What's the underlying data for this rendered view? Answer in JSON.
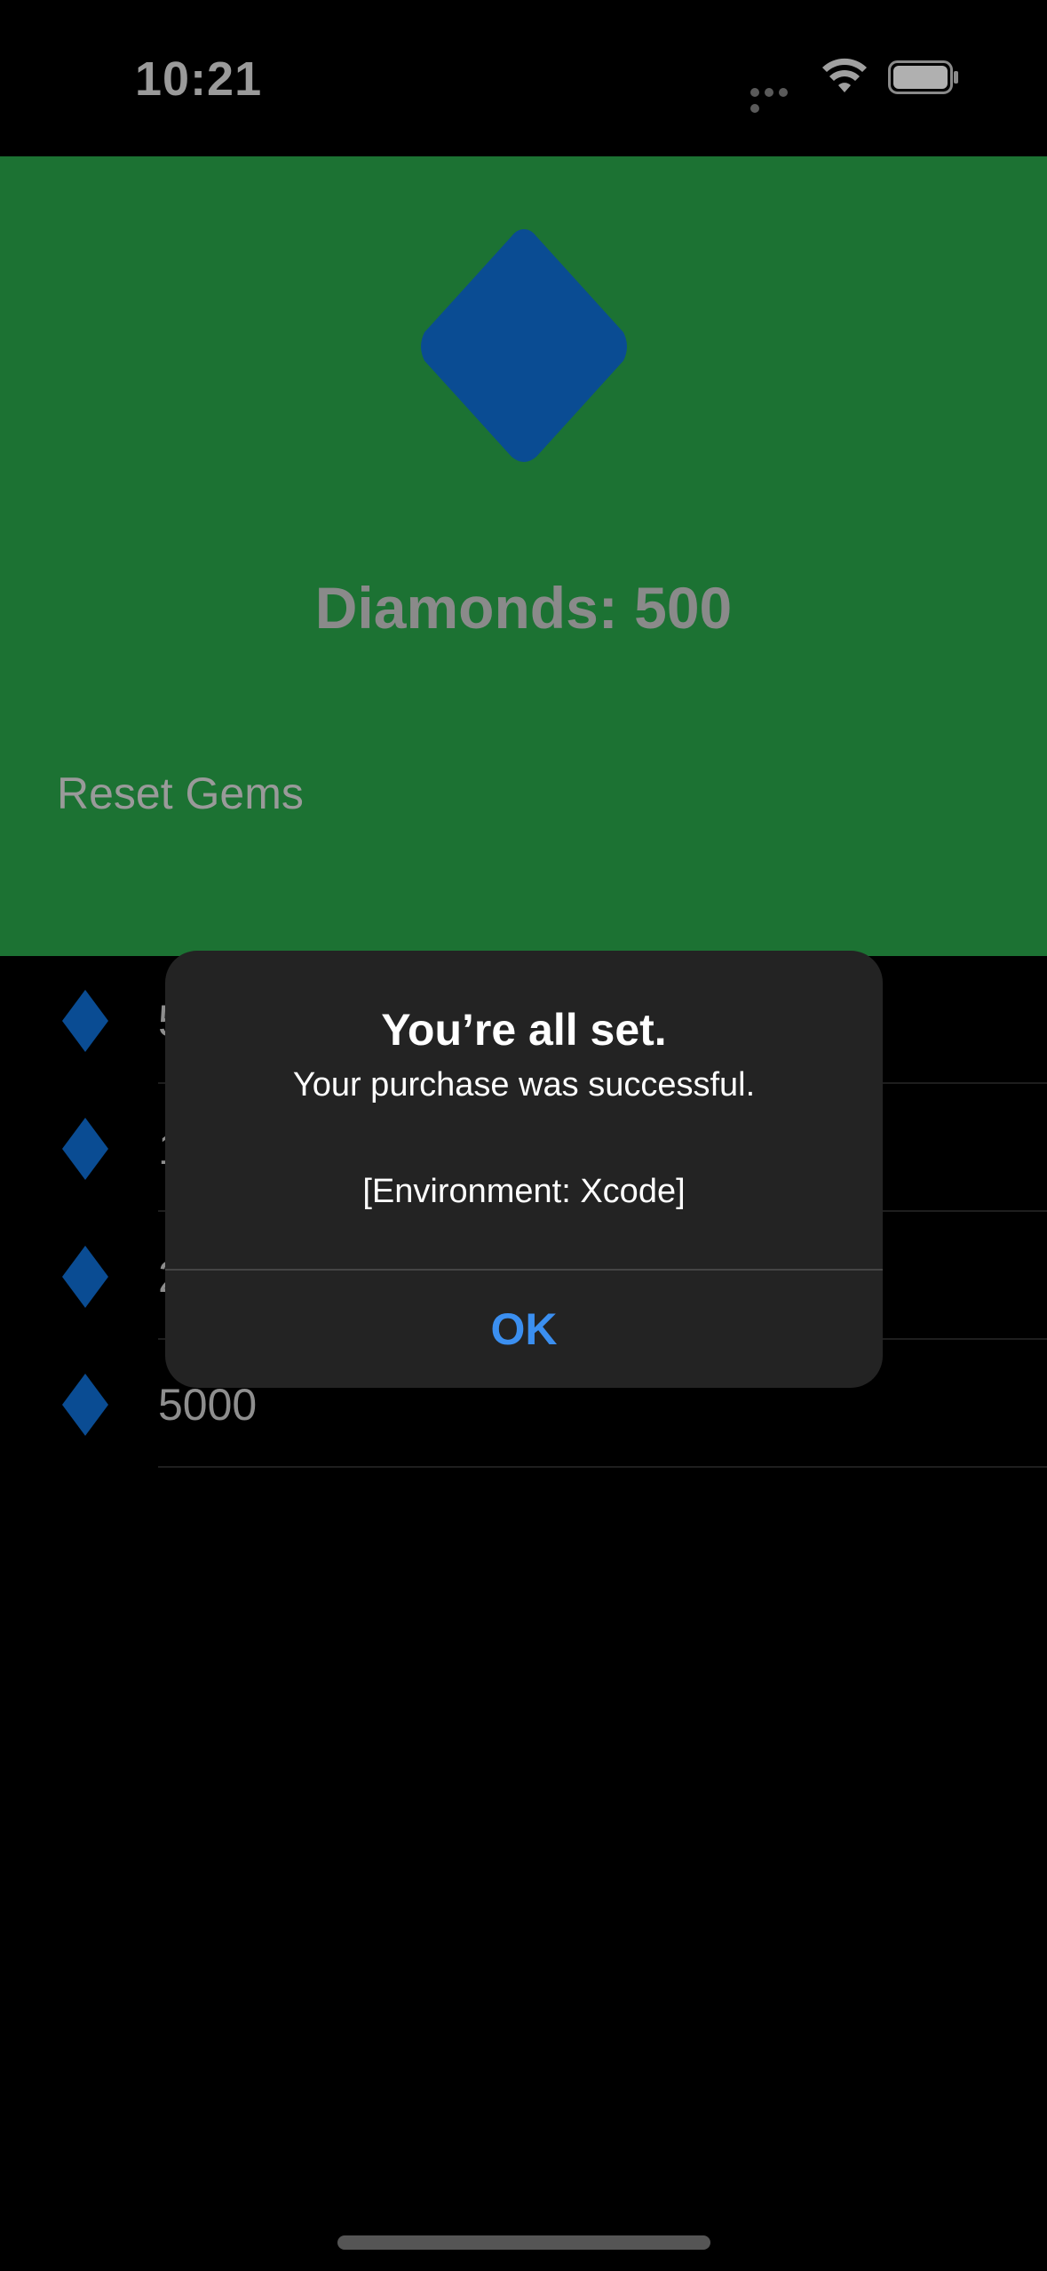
{
  "status_bar": {
    "time": "10:21",
    "icons": [
      "signal-dots-icon",
      "wifi-icon",
      "battery-icon"
    ]
  },
  "header": {
    "background": "#1c7233",
    "hero_icon": "diamond-icon",
    "title": "Diamonds: 500",
    "reset_label": "Reset Gems"
  },
  "products": [
    {
      "label": "5",
      "icon": "diamond-icon"
    },
    {
      "label": "1",
      "icon": "diamond-icon"
    },
    {
      "label": "2",
      "icon": "diamond-icon"
    },
    {
      "label": "5000",
      "icon": "diamond-icon"
    }
  ],
  "alert": {
    "title": "You’re all set.",
    "message": "Your purchase was successful.",
    "environment": "[Environment: Xcode]",
    "ok_label": "OK"
  },
  "colors": {
    "diamond": "#0a4c93",
    "accent": "#3b8ff0",
    "alert_background": "#232323"
  }
}
